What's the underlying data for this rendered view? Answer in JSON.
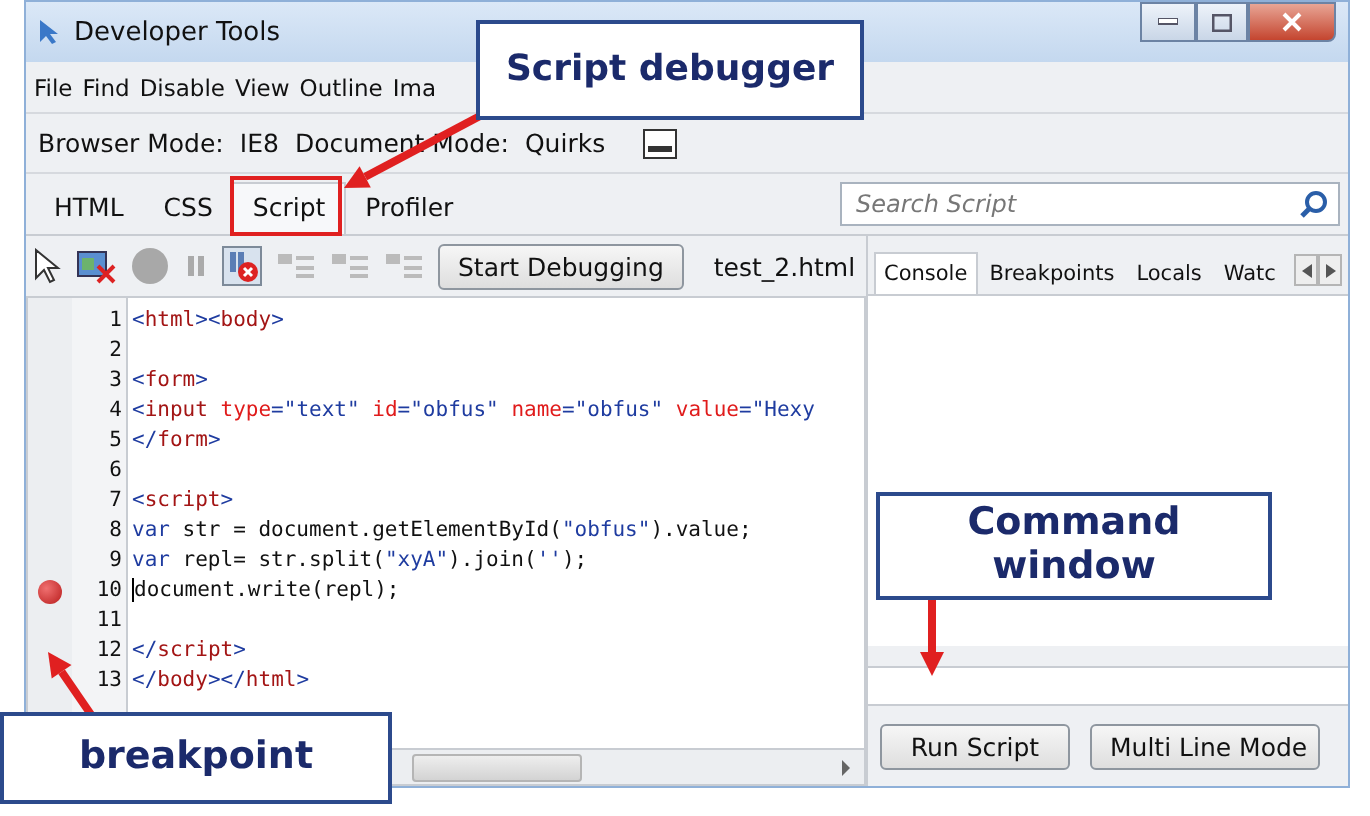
{
  "window": {
    "title": "Developer Tools"
  },
  "menu": [
    "File",
    "Find",
    "Disable",
    "View",
    "Outline",
    "Ima"
  ],
  "modes": [
    {
      "label": "Browser Mode:",
      "value": "IE8"
    },
    {
      "label": "Document Mode:",
      "value": "Quirks"
    }
  ],
  "tabs": [
    {
      "label": "HTML",
      "selected": false
    },
    {
      "label": "CSS",
      "selected": false
    },
    {
      "label": "Script",
      "selected": true
    },
    {
      "label": "Profiler",
      "selected": false
    }
  ],
  "search": {
    "placeholder": "Search Script"
  },
  "toolbar": {
    "break_on_error": true,
    "start_button": "Start Debugging",
    "file": "test_2.html"
  },
  "code": [
    {
      "number": "1",
      "breakpoint": false,
      "tokens": [
        {
          "kind": "bracket",
          "text": "<"
        },
        {
          "kind": "tag",
          "text": "html"
        },
        {
          "kind": "bracket",
          "text": "><"
        },
        {
          "kind": "tag",
          "text": "body"
        },
        {
          "kind": "bracket",
          "text": ">"
        }
      ]
    },
    {
      "number": "2",
      "breakpoint": false
    },
    {
      "number": "3",
      "breakpoint": false,
      "tokens": [
        {
          "kind": "bracket",
          "text": "<"
        },
        {
          "kind": "tag",
          "text": "form"
        },
        {
          "kind": "bracket",
          "text": ">"
        }
      ]
    },
    {
      "number": "4",
      "breakpoint": false,
      "tokens": [
        {
          "kind": "bracket",
          "text": "<"
        },
        {
          "kind": "tag",
          "text": "input"
        },
        {
          "kind": "attr",
          "text": " type"
        },
        {
          "kind": "bracket",
          "text": "="
        },
        {
          "kind": "string",
          "text": "\"text\""
        },
        {
          "kind": "attr",
          "text": " id"
        },
        {
          "kind": "bracket",
          "text": "="
        },
        {
          "kind": "string",
          "text": "\"obfus\""
        },
        {
          "kind": "attr",
          "text": " name"
        },
        {
          "kind": "bracket",
          "text": "="
        },
        {
          "kind": "string",
          "text": "\"obfus\""
        },
        {
          "kind": "attr",
          "text": " value"
        },
        {
          "kind": "bracket",
          "text": "="
        },
        {
          "kind": "string",
          "text": "\"Hexy"
        }
      ]
    },
    {
      "number": "5",
      "breakpoint": false,
      "tokens": [
        {
          "kind": "bracket",
          "text": "</"
        },
        {
          "kind": "tag",
          "text": "form"
        },
        {
          "kind": "bracket",
          "text": ">"
        }
      ]
    },
    {
      "number": "6",
      "breakpoint": false
    },
    {
      "number": "7",
      "breakpoint": false,
      "tokens": [
        {
          "kind": "bracket",
          "text": "<"
        },
        {
          "kind": "tag",
          "text": "script"
        },
        {
          "kind": "bracket",
          "text": ">"
        }
      ]
    },
    {
      "number": "8",
      "breakpoint": false,
      "tokens": [
        {
          "kind": "keyword",
          "text": "var"
        },
        {
          "kind": "plain",
          "text": " str = document.getElementById("
        },
        {
          "kind": "string",
          "text": "\"obfus\""
        },
        {
          "kind": "plain",
          "text": ").value;"
        }
      ]
    },
    {
      "number": "9",
      "breakpoint": false,
      "tokens": [
        {
          "kind": "keyword",
          "text": "var"
        },
        {
          "kind": "plain",
          "text": " repl= str.split("
        },
        {
          "kind": "string",
          "text": "\"xyA\""
        },
        {
          "kind": "plain",
          "text": ").join("
        },
        {
          "kind": "string",
          "text": "''"
        },
        {
          "kind": "plain",
          "text": ");"
        }
      ]
    },
    {
      "number": "10",
      "breakpoint": true,
      "tokens": [
        {
          "kind": "plain",
          "text": "document.write(repl);"
        }
      ]
    },
    {
      "number": "11",
      "breakpoint": false
    },
    {
      "number": "12",
      "breakpoint": false,
      "tokens": [
        {
          "kind": "bracket",
          "text": "</"
        },
        {
          "kind": "tag",
          "text": "script"
        },
        {
          "kind": "bracket",
          "text": ">"
        }
      ]
    },
    {
      "number": "13",
      "breakpoint": false,
      "tokens": [
        {
          "kind": "bracket",
          "text": "</"
        },
        {
          "kind": "tag",
          "text": "body"
        },
        {
          "kind": "bracket",
          "text": "></"
        },
        {
          "kind": "tag",
          "text": "html"
        },
        {
          "kind": "bracket",
          "text": ">"
        }
      ]
    }
  ],
  "side_tabs": [
    {
      "label": "Console",
      "selected": true
    },
    {
      "label": "Breakpoints",
      "selected": false
    },
    {
      "label": "Locals",
      "selected": false
    },
    {
      "label": "Watc",
      "selected": false
    }
  ],
  "console_buttons": [
    "Run Script",
    "Multi Line Mode"
  ],
  "callouts": [
    {
      "kind": "tab",
      "text": "Script debugger"
    },
    {
      "kind": "console",
      "text": "Command window"
    },
    {
      "kind": "gutter",
      "text": "breakpoint"
    }
  ]
}
